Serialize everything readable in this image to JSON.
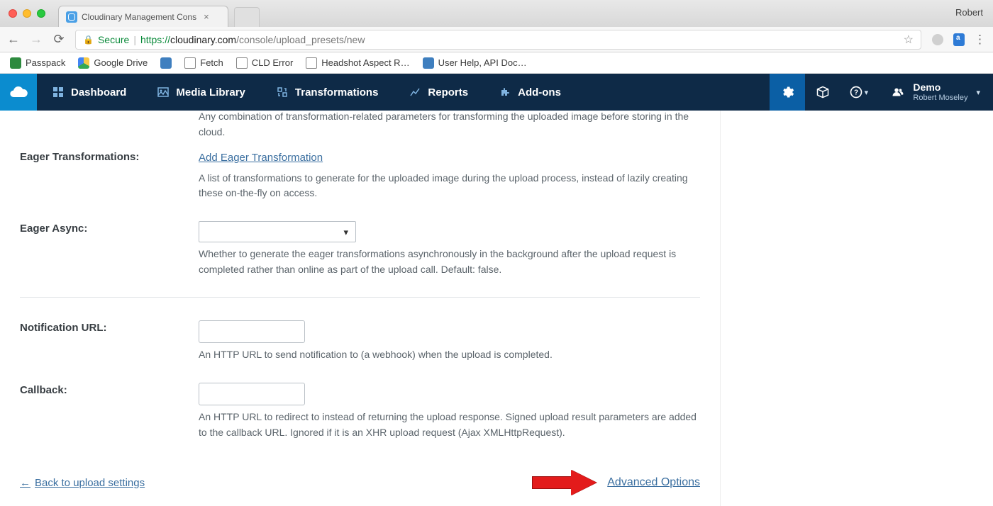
{
  "chrome": {
    "tab_title": "Cloudinary Management Cons",
    "profile_name": "Robert"
  },
  "urlbar": {
    "secure_label": "Secure",
    "proto": "https://",
    "host": "cloudinary.com",
    "path": "/console/upload_presets/new"
  },
  "bookmarks": {
    "passpack": "Passpack",
    "gdrive": "Google Drive",
    "fetch": "Fetch",
    "cld_error": "CLD Error",
    "headshot": "Headshot Aspect R…",
    "userhelp": "User Help, API Doc…"
  },
  "nav": {
    "dashboard": "Dashboard",
    "media_library": "Media Library",
    "transformations": "Transformations",
    "reports": "Reports",
    "addons": "Add-ons",
    "account_name": "Demo",
    "account_user": "Robert Moseley"
  },
  "form": {
    "truncated_top": "Any combination of transformation-related parameters for transforming the uploaded image before storing in the cloud.",
    "eager_trans_label": "Eager Transformations:",
    "eager_trans_link": "Add Eager Transformation",
    "eager_trans_hint": "A list of transformations to generate for the uploaded image during the upload process, instead of lazily creating these on-the-fly on access.",
    "eager_async_label": "Eager Async:",
    "eager_async_hint": "Whether to generate the eager transformations asynchronously in the background after the upload request is completed rather than online as part of the upload call. Default: false.",
    "notif_label": "Notification URL:",
    "notif_hint": "An HTTP URL to send notification to (a webhook) when the upload is completed.",
    "callback_label": "Callback:",
    "callback_hint": "An HTTP URL to redirect to instead of returning the upload response. Signed upload result parameters are added to the callback URL. Ignored if it is an XHR upload request (Ajax XMLHttpRequest).",
    "back_link": "Back to upload settings",
    "advanced_link": "Advanced Options"
  }
}
